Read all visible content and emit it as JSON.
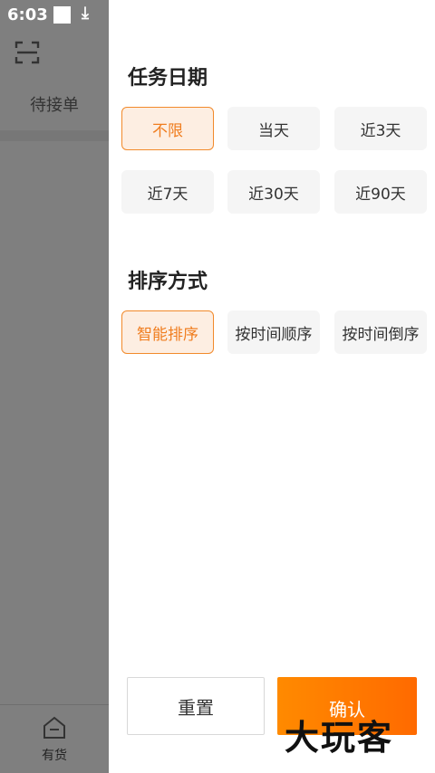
{
  "status_bar": {
    "time": "6:03"
  },
  "background_page": {
    "title": "待接单",
    "bottom_nav_label": "有货"
  },
  "filter": {
    "date_section": {
      "title": "任务日期",
      "options": [
        "不限",
        "当天",
        "近3天",
        "近7天",
        "近30天",
        "近90天"
      ],
      "selected": "不限"
    },
    "sort_section": {
      "title": "排序方式",
      "options": [
        "智能排序",
        "按时间顺序",
        "按时间倒序"
      ],
      "selected": "智能排序"
    },
    "buttons": {
      "reset": "重置",
      "confirm": "确认"
    }
  },
  "watermark": "大玩客",
  "colors": {
    "accent": "#f28a2b",
    "accent_bg": "#fdeee2",
    "overlay": "#7f7f7f"
  }
}
